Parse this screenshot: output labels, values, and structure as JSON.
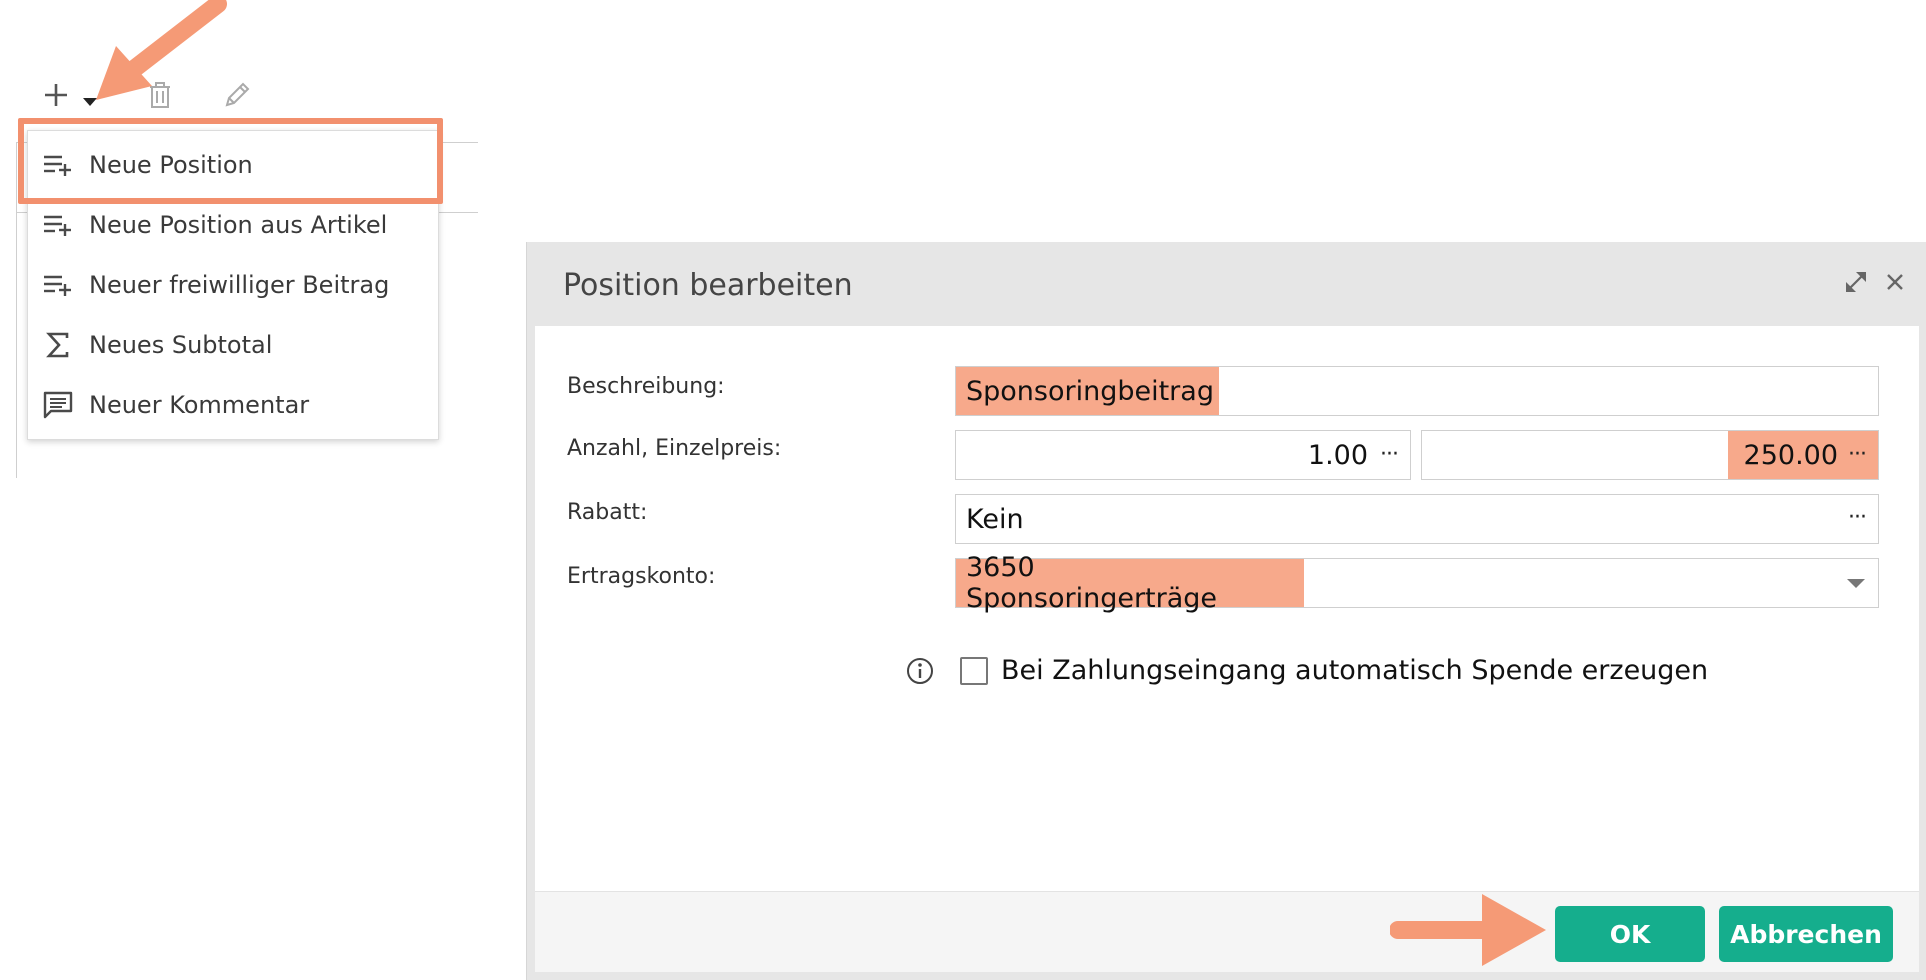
{
  "toolbar": {
    "add_icon": "plus-icon",
    "dropdown_icon": "caret-down-icon",
    "delete_icon": "trash-icon",
    "edit_icon": "pencil-icon"
  },
  "menu": {
    "items": [
      {
        "label": "Neue Position",
        "icon": "list-add-icon"
      },
      {
        "label": "Neue Position aus Artikel",
        "icon": "list-add-icon"
      },
      {
        "label": "Neuer freiwilliger Beitrag",
        "icon": "list-add-icon"
      },
      {
        "label": "Neues Subtotal",
        "icon": "sigma-icon"
      },
      {
        "label": "Neuer Kommentar",
        "icon": "comment-icon"
      }
    ]
  },
  "dialog": {
    "title": "Position bearbeiten",
    "fields": {
      "description": {
        "label": "Beschreibung:",
        "value": "Sponsoringbeitrag"
      },
      "quantity_price": {
        "label": "Anzahl, Einzelpreis:",
        "quantity": "1.00",
        "price": "250.00"
      },
      "discount": {
        "label": "Rabatt:",
        "value": "Kein"
      },
      "revenue_account": {
        "label": "Ertragskonto:",
        "value": "3650 Sponsoringerträge"
      }
    },
    "more_glyph": "···",
    "checkbox": {
      "label": "Bei Zahlungseingang automatisch Spende erzeugen",
      "checked": false
    },
    "buttons": {
      "ok": "OK",
      "cancel": "Abbrechen"
    }
  },
  "colors": {
    "accent": "#15ae8d",
    "highlight": "#f7a98b",
    "annotation": "#f2906e",
    "dialog_header": "#e6e6e6"
  }
}
